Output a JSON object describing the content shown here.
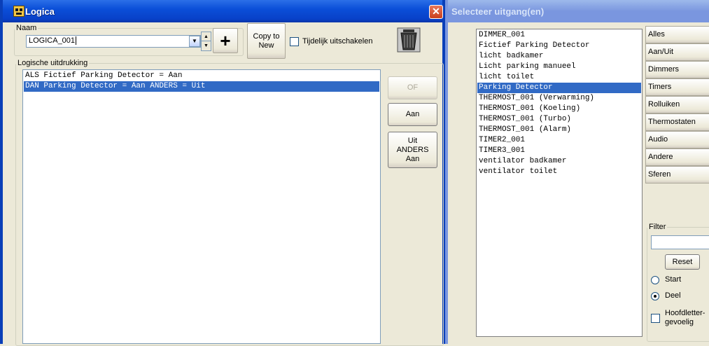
{
  "logica_window": {
    "title": "Logica",
    "close": "✕",
    "naam_label": "Naam",
    "naam_value": "LOGICA_001",
    "add_symbol": "+",
    "copy_button": "Copy to New",
    "tijdelijk_label": "Tijdelijk uitschakelen",
    "expr_group_label": "Logische uitdrukking",
    "expressions": [
      {
        "text": "ALS Fictief Parking Detector = Aan",
        "selected": false
      },
      {
        "text": "DAN Parking Detector = Aan ANDERS = Uit",
        "selected": true
      }
    ],
    "of_button": "OF",
    "aan_button": "Aan",
    "uit_anders_button": "Uit ANDERS Aan"
  },
  "selecteer_window": {
    "title": "Selecteer uitgang(en)",
    "outputs": [
      {
        "text": "DIMMER_001",
        "selected": false
      },
      {
        "text": "Fictief Parking Detector",
        "selected": false
      },
      {
        "text": "licht badkamer",
        "selected": false
      },
      {
        "text": "Licht parking manueel",
        "selected": false
      },
      {
        "text": "licht toilet",
        "selected": false
      },
      {
        "text": "Parking Detector",
        "selected": true
      },
      {
        "text": "THERMOST_001 (Verwarming)",
        "selected": false
      },
      {
        "text": "THERMOST_001 (Koeling)",
        "selected": false
      },
      {
        "text": "THERMOST_001 (Turbo)",
        "selected": false
      },
      {
        "text": "THERMOST_001 (Alarm)",
        "selected": false
      },
      {
        "text": "TIMER2_001",
        "selected": false
      },
      {
        "text": "TIMER3_001",
        "selected": false
      },
      {
        "text": "ventilator badkamer",
        "selected": false
      },
      {
        "text": "ventilator toilet",
        "selected": false
      }
    ],
    "categories": [
      "Alles",
      "Aan/Uit",
      "Dimmers",
      "Timers",
      "Rolluiken",
      "Thermostaten",
      "Audio",
      "Andere",
      "Sferen"
    ],
    "filter_label": "Filter",
    "filter_value": "",
    "reset_button": "Reset",
    "radio_start": "Start",
    "radio_deel": "Deel",
    "radio_selected": "Deel",
    "hoofdletter_line1": "Hoofdletter-",
    "hoofdletter_line2": "gevoelig"
  },
  "colors": {
    "titlebar_active": "#0b4fd8",
    "titlebar_inactive": "#7a96df",
    "selection": "#316ac5",
    "window_bg": "#ece9d8"
  }
}
